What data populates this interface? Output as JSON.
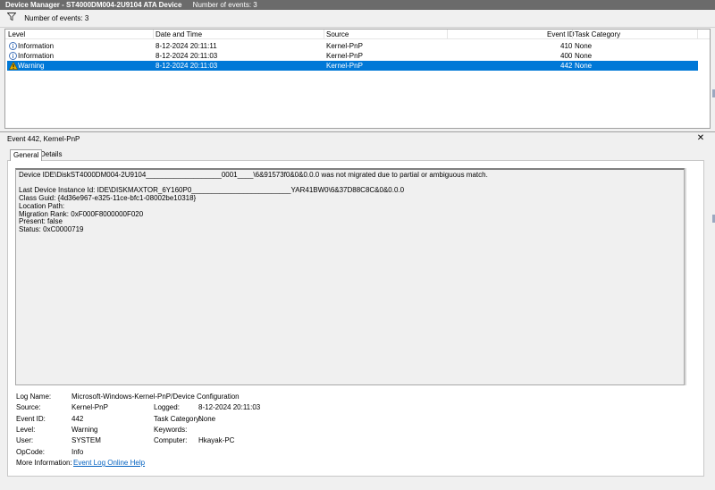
{
  "window": {
    "title": "Device Manager - ST4000DM004-2U9104 ATA Device",
    "subtitle": "Number of events: 3"
  },
  "filter": {
    "icon": "filter-icon",
    "label": "Number of events: 3"
  },
  "grid": {
    "columns": [
      "Level",
      "Date and Time",
      "Source",
      "Event ID",
      "Task Category"
    ],
    "rows": [
      {
        "icon": "information-icon",
        "level": "Information",
        "datetime": "8-12-2024 20:11:11",
        "source": "Kernel-PnP",
        "event_id": "410",
        "category": "None",
        "selected": false
      },
      {
        "icon": "information-icon",
        "level": "Information",
        "datetime": "8-12-2024 20:11:03",
        "source": "Kernel-PnP",
        "event_id": "400",
        "category": "None",
        "selected": false
      },
      {
        "icon": "warning-icon",
        "level": "Warning",
        "datetime": "8-12-2024 20:11:03",
        "source": "Kernel-PnP",
        "event_id": "442",
        "category": "None",
        "selected": true
      }
    ]
  },
  "detail": {
    "title": "Event 442, Kernel-PnP",
    "close": "✕",
    "tabs": [
      "General",
      "Details"
    ],
    "message": [
      "Device IDE\\DiskST4000DM004-2U9104___________________0001____\\6&91573f0&0&0.0.0 was not migrated due to partial or ambiguous match.",
      "",
      "Last Device Instance Id: IDE\\DISKMAXTOR_6Y160P0_________________________YAR41BW0\\6&37D88C8C&0&0.0.0",
      "Class Guid: {4d36e967-e325-11ce-bfc1-08002be10318}",
      "Location Path:",
      "Migration Rank: 0xF000F8000000F020",
      "Present: false",
      "Status: 0xC0000719"
    ],
    "fields": {
      "log_name_label": "Log Name:",
      "log_name": "Microsoft-Windows-Kernel-PnP/Device Configuration",
      "source_label": "Source:",
      "source": "Kernel-PnP",
      "logged_label": "Logged:",
      "logged": "8-12-2024 20:11:03",
      "event_id_label": "Event ID:",
      "event_id": "442",
      "task_category_label": "Task Category:",
      "task_category": "None",
      "level_label": "Level:",
      "level": "Warning",
      "keywords_label": "Keywords:",
      "keywords": "",
      "user_label": "User:",
      "user": "SYSTEM",
      "computer_label": "Computer:",
      "computer": "Hkayak-PC",
      "opcode_label": "OpCode:",
      "opcode": "Info",
      "more_info_label": "More Information:",
      "more_info_link": "Event Log Online Help"
    }
  },
  "colors": {
    "selection": "#0078d7",
    "titlebar": "#6b6b6b",
    "link": "#0563c1",
    "warning": "#e8b000",
    "info": "#3c6fb8"
  }
}
